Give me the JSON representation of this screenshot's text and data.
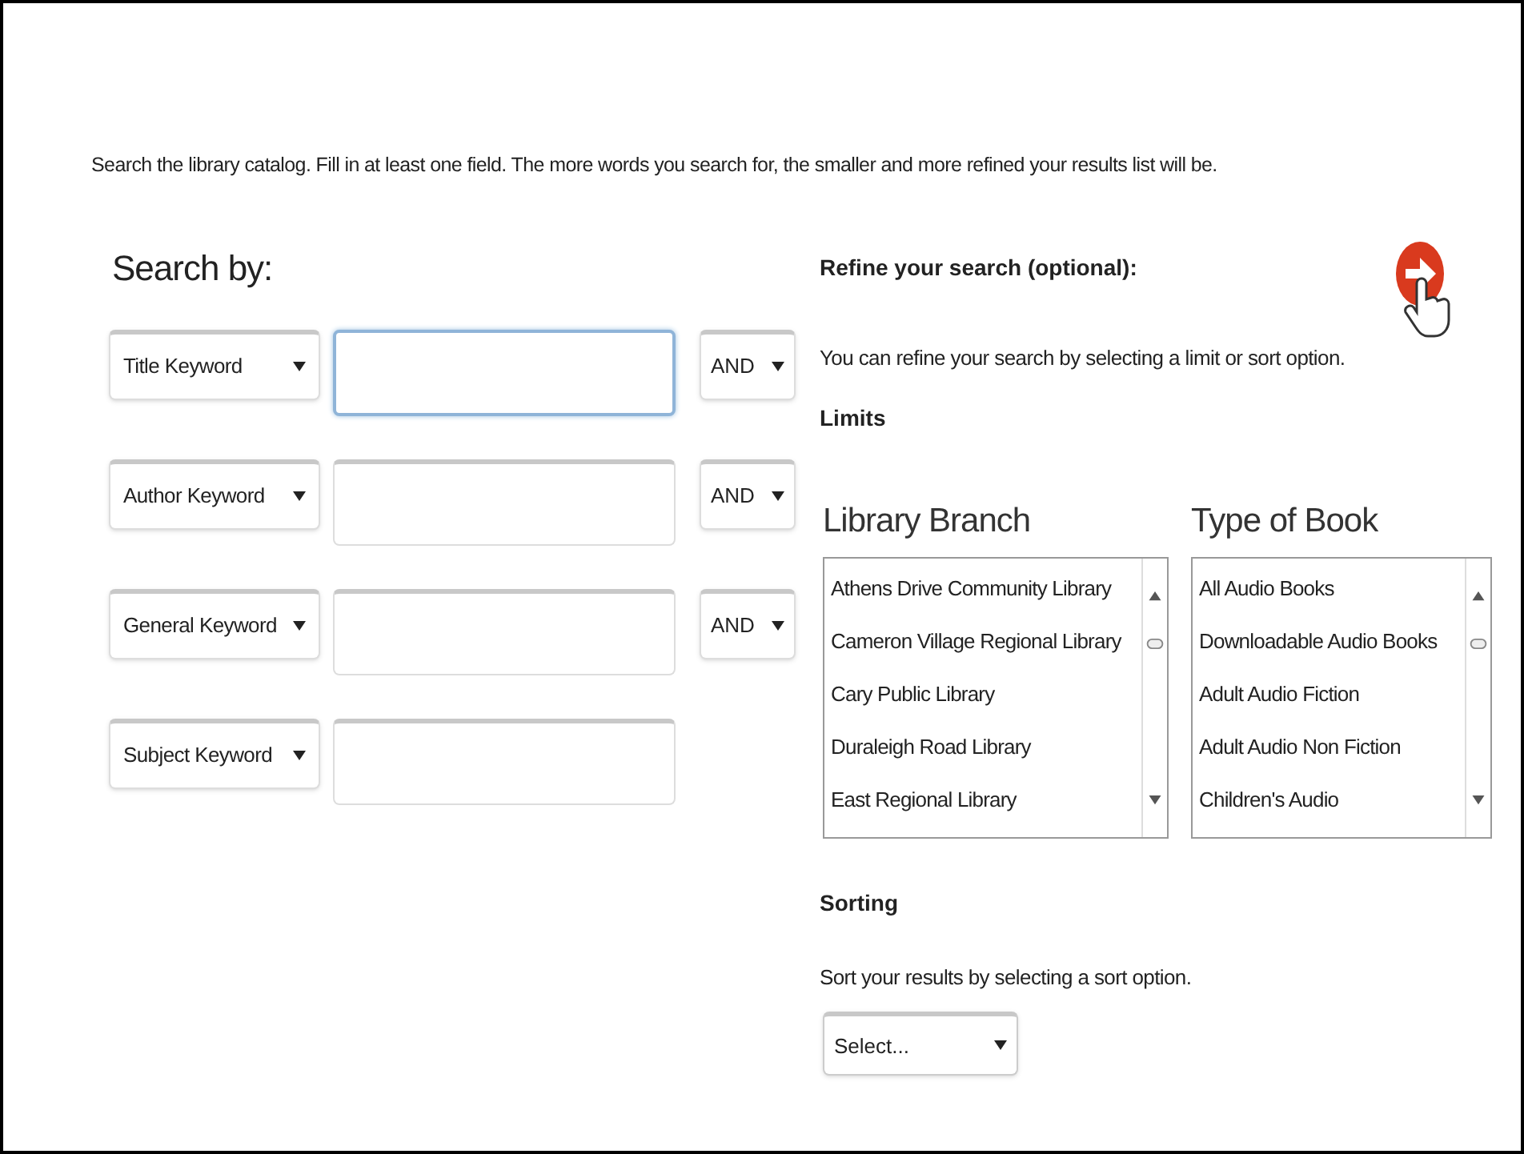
{
  "intro": "Search the library catalog. Fill in at least one field. The more words you search for, the smaller and more refined your results list will be.",
  "search_by": {
    "heading": "Search by:",
    "rows": [
      {
        "field": "Title Keyword",
        "focused": true,
        "conjunction": "AND"
      },
      {
        "field": "Author Keyword",
        "focused": false,
        "conjunction": "AND"
      },
      {
        "field": "General Keyword",
        "focused": false,
        "conjunction": "AND"
      },
      {
        "field": "Subject Keyword",
        "focused": false
      }
    ]
  },
  "refine": {
    "heading": "Refine your search (optional):",
    "description": "You can refine your search by selecting a limit or sort option.",
    "limits_heading": "Limits",
    "lists": [
      {
        "label": "Library Branch",
        "items": [
          "Athens Drive Community Library",
          "Cameron Village Regional Library",
          "Cary Public Library",
          "Duraleigh Road Library",
          "East Regional Library"
        ]
      },
      {
        "label": "Type of Book",
        "items": [
          "All Audio Books",
          "Downloadable Audio Books",
          "Adult Audio Fiction",
          "Adult Audio Non Fiction",
          "Children's Audio"
        ]
      }
    ]
  },
  "sorting": {
    "heading": "Sorting",
    "description": "Sort your results by selecting a sort option.",
    "select": "Select..."
  }
}
